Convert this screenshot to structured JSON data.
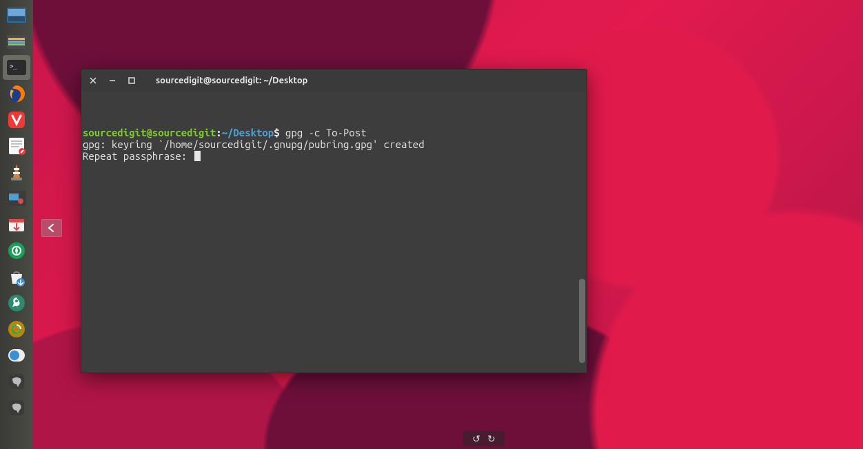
{
  "desktop": {
    "back_widget_icon": "arrow-left"
  },
  "dock": {
    "items": [
      {
        "name": "workspace-switcher",
        "active": false
      },
      {
        "name": "files-nautilus",
        "active": false
      },
      {
        "name": "terminal",
        "active": true
      },
      {
        "name": "firefox",
        "active": false
      },
      {
        "name": "vivaldi",
        "active": false
      },
      {
        "name": "text-editor",
        "active": false
      },
      {
        "name": "vlc",
        "active": false
      },
      {
        "name": "screenshot-tool",
        "active": false
      },
      {
        "name": "software-updater",
        "active": false
      },
      {
        "name": "shutter",
        "active": false
      },
      {
        "name": "software-center",
        "active": false
      },
      {
        "name": "settings-wrench",
        "active": false
      },
      {
        "name": "sync-app",
        "active": false
      },
      {
        "name": "toggle-panel",
        "active": false
      },
      {
        "name": "chat-app-1",
        "active": false
      },
      {
        "name": "chat-app-2",
        "active": false
      }
    ]
  },
  "terminal": {
    "title": "sourcedigit@sourcedigit: ~/Desktop",
    "prompt": {
      "user_host": "sourcedigit@sourcedigit",
      "separator": ":",
      "path": "~/Desktop",
      "symbol": "$"
    },
    "command": " gpg -c To-Post",
    "lines": [
      "gpg: keyring `/home/sourcedigit/.gnupg/pubring.gpg' created",
      "Repeat passphrase: "
    ]
  },
  "bottom_controls": {
    "undo": "↺",
    "redo": "↻"
  }
}
